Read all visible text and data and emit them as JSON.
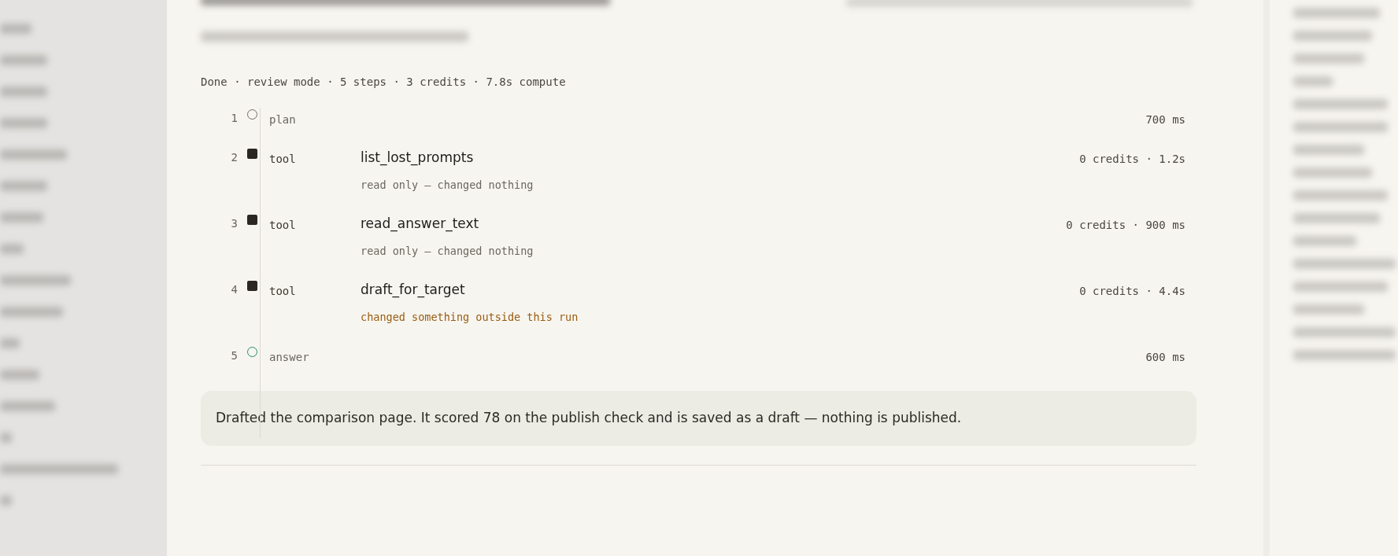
{
  "run_summary": "Done · review mode · 5 steps · 3 credits · 7.8s compute",
  "steps": [
    {
      "number": "1",
      "kind": "plan",
      "label": "plan",
      "cost": "700 ms"
    },
    {
      "number": "2",
      "kind": "tool",
      "label": "tool",
      "tool_name": "list_lost_prompts",
      "cost": "0 credits · 1.2s",
      "effect": "read only — changed nothing",
      "changed_outside": false
    },
    {
      "number": "3",
      "kind": "tool",
      "label": "tool",
      "tool_name": "read_answer_text",
      "cost": "0 credits · 900 ms",
      "effect": "read only — changed nothing",
      "changed_outside": false
    },
    {
      "number": "4",
      "kind": "tool",
      "label": "tool",
      "tool_name": "draft_for_target",
      "cost": "0 credits · 4.4s",
      "effect": "changed something outside this run",
      "changed_outside": true
    },
    {
      "number": "5",
      "kind": "answer",
      "label": "answer",
      "cost": "600 ms"
    }
  ],
  "answer_text": "Drafted the comparison page. It scored 78 on the publish check and is saved as a draft — nothing is published."
}
